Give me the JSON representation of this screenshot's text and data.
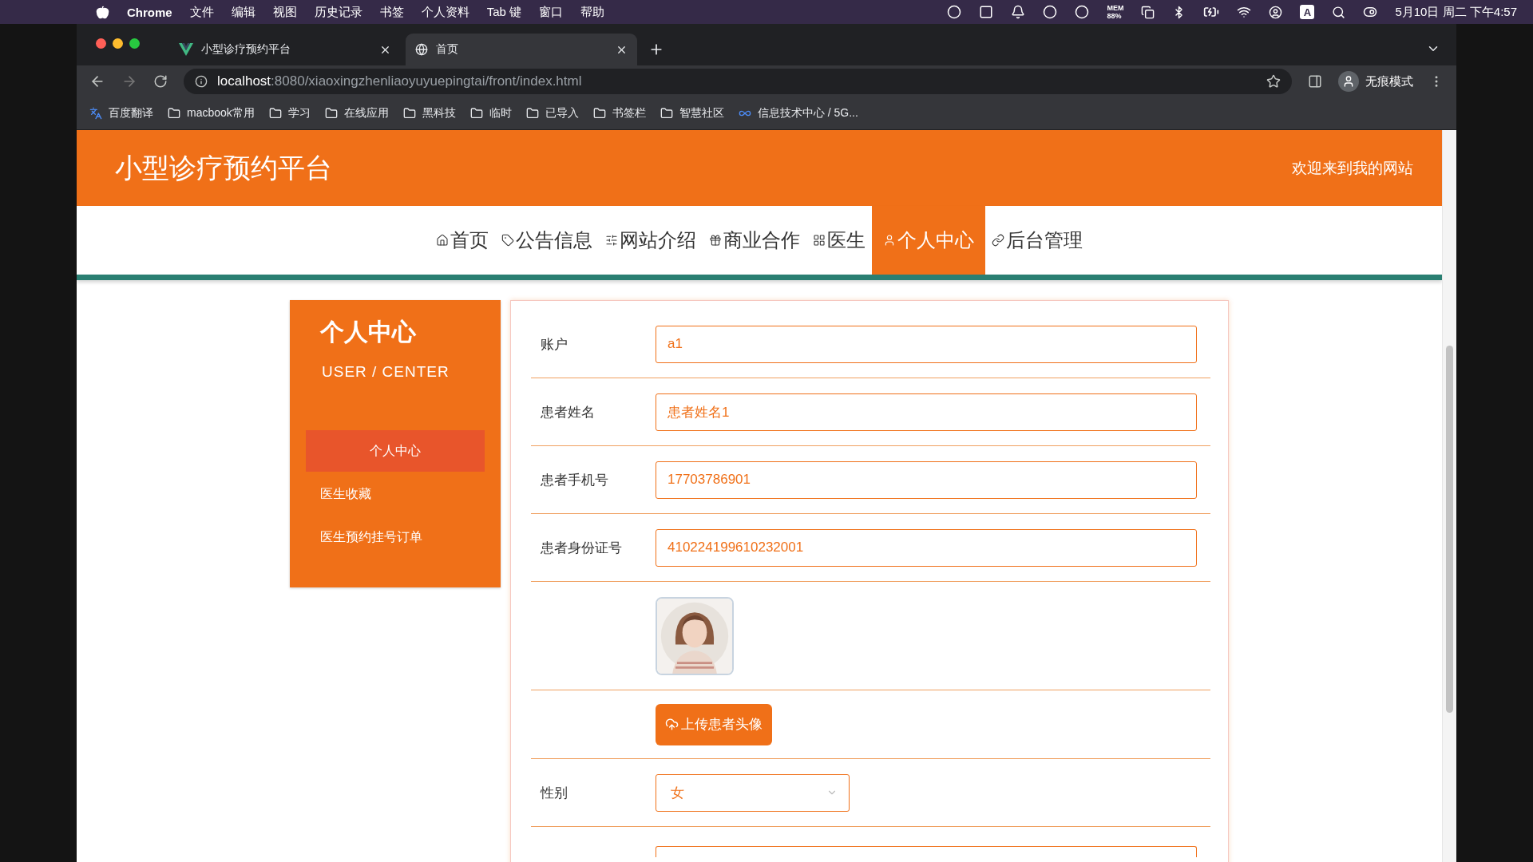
{
  "menubar": {
    "app": "Chrome",
    "menus": [
      "文件",
      "编辑",
      "视图",
      "历史记录",
      "书签",
      "个人资料",
      "Tab 键",
      "窗口",
      "帮助"
    ],
    "mem_label": "MEM",
    "mem_value": "88%",
    "ime": "A",
    "clock": "5月10日 周二 下午4:57"
  },
  "browser": {
    "tabs": [
      {
        "title": "小型诊疗预约平台",
        "kind": "vue",
        "selected": false
      },
      {
        "title": "首页",
        "kind": "globe",
        "selected": true
      }
    ],
    "url_host": "localhost",
    "url_path": ":8080/xiaoxingzhenliaoyuyuepingtai/front/index.html",
    "profile": "无痕模式",
    "bookmarks": [
      {
        "label": "百度翻译",
        "kind": "translate"
      },
      {
        "label": "macbook常用",
        "kind": "folder"
      },
      {
        "label": "学习",
        "kind": "folder"
      },
      {
        "label": "在线应用",
        "kind": "folder"
      },
      {
        "label": "黑科技",
        "kind": "folder"
      },
      {
        "label": "临时",
        "kind": "folder"
      },
      {
        "label": "已导入",
        "kind": "folder"
      },
      {
        "label": "书签栏",
        "kind": "folder"
      },
      {
        "label": "智慧社区",
        "kind": "folder"
      },
      {
        "label": "信息技术中心 / 5G...",
        "kind": "link"
      }
    ]
  },
  "site": {
    "title": "小型诊疗预约平台",
    "welcome": "欢迎来到我的网站",
    "nav": [
      {
        "label": "首页",
        "selected": false
      },
      {
        "label": "公告信息",
        "selected": false
      },
      {
        "label": "网站介绍",
        "selected": false
      },
      {
        "label": "商业合作",
        "selected": false
      },
      {
        "label": "医生",
        "selected": false
      },
      {
        "label": "个人中心",
        "selected": true
      },
      {
        "label": "后台管理",
        "selected": false
      }
    ]
  },
  "sidebar": {
    "title": "个人中心",
    "subtitle": "USER / CENTER",
    "items": [
      {
        "label": "个人中心",
        "selected": true
      },
      {
        "label": "医生收藏",
        "selected": false
      },
      {
        "label": "医生预约挂号订单",
        "selected": false
      }
    ]
  },
  "form": {
    "fields": [
      {
        "kind": "text",
        "label": "账户",
        "value": "a1"
      },
      {
        "kind": "text",
        "label": "患者姓名",
        "value": "患者姓名1"
      },
      {
        "kind": "text",
        "label": "患者手机号",
        "value": "17703786901"
      },
      {
        "kind": "text",
        "label": "患者身份证号",
        "value": "410224199610232001"
      },
      {
        "kind": "avatar"
      },
      {
        "kind": "upload",
        "button": "上传患者头像"
      },
      {
        "kind": "select",
        "label": "性别",
        "value": "女"
      },
      {
        "kind": "partial"
      }
    ]
  }
}
